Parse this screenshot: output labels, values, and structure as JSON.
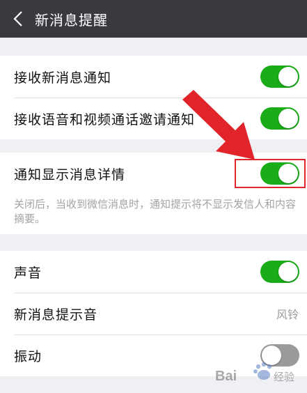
{
  "header": {
    "title": "新消息提醒",
    "back_icon": "chevron-left-icon"
  },
  "settings": {
    "receive_new_message": {
      "label": "接收新消息通知",
      "enabled": true
    },
    "receive_voice_video": {
      "label": "接收语音和视频通话邀请通知",
      "enabled": true
    },
    "show_message_detail": {
      "label": "通知显示消息详情",
      "enabled": true,
      "description": "关闭后，当收到微信消息时，通知提示将不显示发信人和内容摘要。"
    },
    "sound": {
      "label": "声音",
      "enabled": true
    },
    "notification_sound": {
      "label": "新消息提示音",
      "value": "风铃"
    },
    "vibrate": {
      "label": "振动",
      "enabled": false
    }
  },
  "colors": {
    "toggle_on": "#1aad19",
    "toggle_off": "#9a9a9a",
    "header_bg": "#393a3f",
    "annotation_red": "#e0242a"
  },
  "watermark": {
    "text": "Bai 经验"
  }
}
